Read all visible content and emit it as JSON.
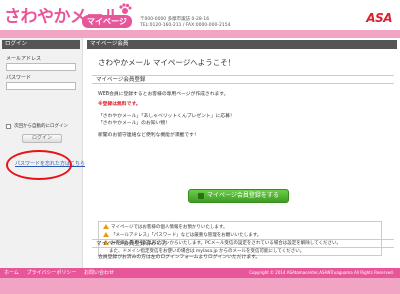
{
  "header": {
    "logo_main": "さわやかメール",
    "logo_sub": "マイページ",
    "address_lines": [
      "〒000-0000 多摩市諏訪 0-28-16",
      "TEL:0120-160-211 / FAX:0000-000-2154"
    ],
    "brand": "ASA"
  },
  "sidebar": {
    "heading": "ログイン",
    "mail_label": "メールアドレス",
    "password_label": "パスワード",
    "remember_label": "次回から自動的にログイン",
    "login_button": "ログイン",
    "forgot_link": "パスワードを忘れた方はこちら"
  },
  "main": {
    "heading": "マイページ会員",
    "welcome": "さわやかメール マイページへようこそ！",
    "section1": "マイページ会員登録",
    "line1": "WEB会員に登録するとお客様の専用ページが作成されます。",
    "line2": "※登録は無料です。",
    "line3": "「さわやかメール」「あしゃべリットくんプレゼント」に応募！",
    "line4": "「さわやかメール」のお知い物！",
    "line5": "新聞のお留守連絡など便利な機能が満載です！",
    "register_button": "マイページ会員登録をする",
    "notes": [
      "マイページではお客様の個人情報をお預かりいたします。",
      "「メールアドレス」「パスワード」などは厳重な管理をお願いいたします。",
      "お客様へのメールはパソコンからいたします。PCメール受信の設定をされている場合は設定を解除してください。",
      "また、ドメイン指定受信をお使いの場合は mylasa.jp からのメールを受信可能にしてください。"
    ],
    "section2": "マイページ会員登録済みの方",
    "line6": "会員登録がお済みの方は左のログインフォームよりログインいただけます。"
  },
  "footer": {
    "nav": [
      "ホーム",
      "プライバシーポリシー",
      "お問い合わせ"
    ],
    "copyright": "Copyright © 2014 ASAtomacenter,ASANTruaguama All Rights Reserved."
  },
  "colors": {
    "brand_pink": "#e8569a",
    "pink_light": "#f2a4c5",
    "button_green": "#4caf2e",
    "highlight_red": "#e8131a"
  }
}
